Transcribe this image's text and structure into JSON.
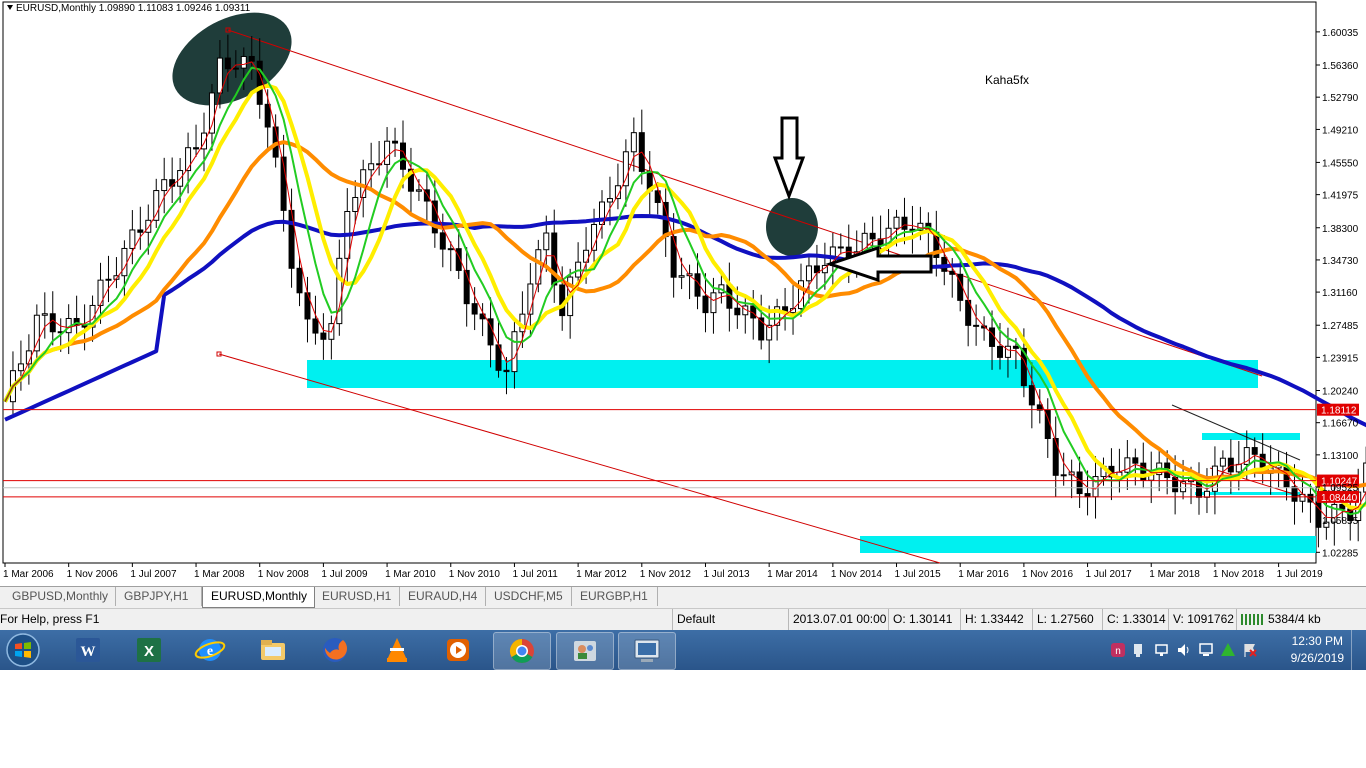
{
  "chart": {
    "title": "EURUSD,Monthly  1.09890 1.11083 1.09246 1.09311",
    "watermark": "Kaha5fx",
    "price_labels": [
      "1.60035",
      "1.56360",
      "1.52790",
      "1.49210",
      "1.45550",
      "1.41975",
      "1.38300",
      "1.34730",
      "1.31160",
      "1.27485",
      "1.23915",
      "1.20240",
      "1.16670",
      "1.13100",
      "1.09525",
      "1.05855",
      "1.02285"
    ],
    "marked_levels": [
      {
        "label": "1.18112",
        "price": 1.18112,
        "color": "#e00000"
      },
      {
        "label": "1.10247",
        "price": 1.10247,
        "color": "#e00000"
      },
      {
        "label": "1.08440",
        "price": 1.0844,
        "color": "#e00000"
      }
    ],
    "time_labels": [
      "1 Mar 2006",
      "1 Nov 2006",
      "1 Jul 2007",
      "1 Mar 2008",
      "1 Nov 2008",
      "1 Jul 2009",
      "1 Mar 2010",
      "1 Nov 2010",
      "1 Jul 2011",
      "1 Mar 2012",
      "1 Nov 2012",
      "1 Jul 2013",
      "1 Mar 2014",
      "1 Nov 2014",
      "1 Jul 2015",
      "1 Mar 2016",
      "1 Nov 2016",
      "1 Jul 2017",
      "1 Mar 2018",
      "1 Nov 2018",
      "1 Jul 2019"
    ],
    "colors": {
      "ma_fast": "#e00000",
      "ma_green": "#22cc22",
      "ma_yellow": "#ffee00",
      "ma_orange": "#ff8c00",
      "ma_blue": "#1010c0",
      "zone": "#00f0f0",
      "channel": "#d00000",
      "highlight": "#1f3d3a"
    }
  },
  "tabs": [
    {
      "label": "GBPUSD,Monthly",
      "active": false
    },
    {
      "label": "GBPJPY,H1",
      "active": false
    },
    {
      "label": "EURUSD,Monthly",
      "active": true
    },
    {
      "label": "EURUSD,H1",
      "active": false
    },
    {
      "label": "EURAUD,H4",
      "active": false
    },
    {
      "label": "USDCHF,M5",
      "active": false
    },
    {
      "label": "EURGBP,H1",
      "active": false
    }
  ],
  "status": {
    "help": "For Help, press F1",
    "profile": "Default",
    "datetime": "2013.07.01 00:00",
    "open": "O: 1.30141",
    "high": "H: 1.33442",
    "low": "L: 1.27560",
    "close": "C: 1.33014",
    "volume": "V: 1091762",
    "traffic": "5384/4 kb"
  },
  "taskbar": {
    "apps": [
      "word-icon",
      "excel-icon",
      "internet-explorer-icon",
      "file-explorer-icon",
      "firefox-icon",
      "vlc-icon",
      "media-player-icon",
      "chrome-icon",
      "remote-assistance-icon",
      "metatrader-icon"
    ],
    "clock_time": "12:30 PM",
    "clock_date": "9/26/2019"
  }
}
